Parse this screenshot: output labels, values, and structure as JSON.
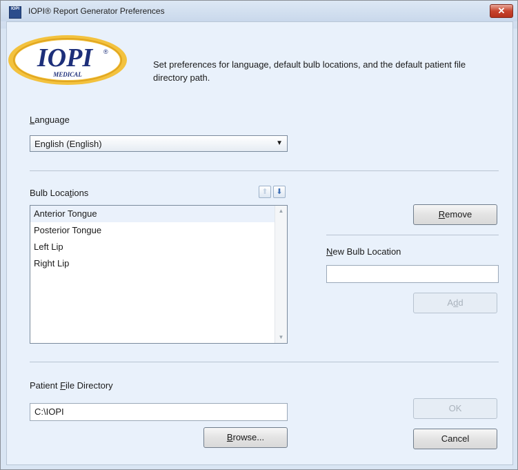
{
  "window": {
    "title": "IOPI® Report Generator Preferences",
    "icon_text": "IOPI",
    "close_label": "✕"
  },
  "logo": {
    "main_text": "IOPI",
    "sub_text": "MEDICAL",
    "registered": "®"
  },
  "description": "Set preferences for language, default bulb locations, and the default patient file directory path.",
  "language": {
    "label_prefix": "",
    "label_accel": "L",
    "label_rest": "anguage",
    "selected": "English (English)"
  },
  "bulb_locations": {
    "label_prefix": "Bulb Loca",
    "label_accel": "t",
    "label_rest": "ions",
    "items": [
      "Anterior Tongue",
      "Posterior Tongue",
      "Left Lip",
      "Right Lip"
    ],
    "selected_index": 0
  },
  "remove_button": {
    "prefix": "",
    "accel": "R",
    "rest": "emove"
  },
  "new_bulb": {
    "label_prefix": "",
    "label_accel": "N",
    "label_rest": "ew Bulb Location",
    "value": ""
  },
  "add_button": {
    "prefix": "A",
    "accel": "d",
    "rest": "d",
    "enabled": false
  },
  "patient_dir": {
    "label_prefix": "Patient ",
    "label_accel": "F",
    "label_rest": "ile Directory",
    "value": "C:\\IOPI"
  },
  "browse_button": {
    "prefix": "",
    "accel": "B",
    "rest": "rowse..."
  },
  "ok_button": {
    "label": "OK",
    "enabled": false
  },
  "cancel_button": {
    "label": "Cancel"
  },
  "colors": {
    "accent": "#2b4d8c",
    "logo_gold": "#f3c23e",
    "logo_blue": "#1d2f7a"
  }
}
